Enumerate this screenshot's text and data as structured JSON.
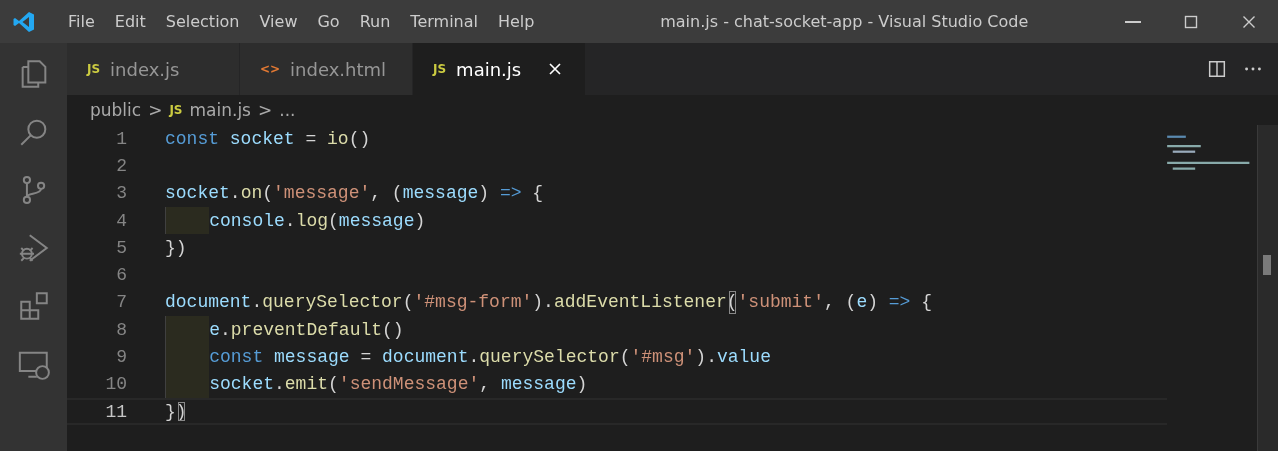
{
  "window": {
    "title": "main.js - chat-socket-app - Visual Studio Code"
  },
  "menu": [
    "File",
    "Edit",
    "Selection",
    "View",
    "Go",
    "Run",
    "Terminal",
    "Help"
  ],
  "tabs": [
    {
      "label": "index.js",
      "kind": "js",
      "icon_text": "JS",
      "selected": false
    },
    {
      "label": "index.html",
      "kind": "html",
      "icon_text": "<>",
      "selected": false
    },
    {
      "label": "main.js",
      "kind": "js",
      "icon_text": "JS",
      "selected": true
    }
  ],
  "breadcrumb": {
    "folder": "public",
    "file_icon": "JS",
    "file": "main.js",
    "separator": ">",
    "more": "..."
  },
  "editor": {
    "lines": [
      {
        "number": "1",
        "indented": false,
        "current": false,
        "tokens": [
          {
            "kind": "kw",
            "text": "const "
          },
          {
            "kind": "var",
            "text": "socket"
          },
          {
            "kind": "punc",
            "text": " = "
          },
          {
            "kind": "fn",
            "text": "io"
          },
          {
            "kind": "punc",
            "text": "()"
          }
        ]
      },
      {
        "number": "2",
        "indented": false,
        "current": false
      },
      {
        "number": "3",
        "indented": false,
        "current": false,
        "tokens": [
          {
            "kind": "var",
            "text": "socket"
          },
          {
            "kind": "punc",
            "text": "."
          },
          {
            "kind": "fn",
            "text": "on"
          },
          {
            "kind": "punc",
            "text": "("
          },
          {
            "kind": "str",
            "text": "'message'"
          },
          {
            "kind": "punc",
            "text": ", ("
          },
          {
            "kind": "var",
            "text": "message"
          },
          {
            "kind": "punc",
            "text": ") "
          },
          {
            "kind": "kw",
            "text": "=>"
          },
          {
            "kind": "punc",
            "text": " {"
          }
        ]
      },
      {
        "number": "4",
        "indented": true,
        "current": false,
        "tokens": [
          {
            "kind": "var",
            "text": "console"
          },
          {
            "kind": "punc",
            "text": "."
          },
          {
            "kind": "fn",
            "text": "log"
          },
          {
            "kind": "punc",
            "text": "("
          },
          {
            "kind": "var",
            "text": "message"
          },
          {
            "kind": "punc",
            "text": ")"
          }
        ]
      },
      {
        "number": "5",
        "indented": false,
        "current": false,
        "tokens": [
          {
            "kind": "punc",
            "text": "})"
          }
        ]
      },
      {
        "number": "6",
        "indented": false,
        "current": false
      },
      {
        "number": "7",
        "indented": false,
        "current": false,
        "tokens": [
          {
            "kind": "var",
            "text": "document"
          },
          {
            "kind": "punc",
            "text": "."
          },
          {
            "kind": "fn",
            "text": "querySelector"
          },
          {
            "kind": "punc",
            "text": "("
          },
          {
            "kind": "str",
            "text": "'#msg-form'"
          },
          {
            "kind": "punc",
            "text": ")."
          },
          {
            "kind": "fn",
            "text": "addEventListener"
          },
          {
            "kind": "bracket",
            "text": "("
          },
          {
            "kind": "str",
            "text": "'submit'"
          },
          {
            "kind": "punc",
            "text": ", ("
          },
          {
            "kind": "var",
            "text": "e"
          },
          {
            "kind": "punc",
            "text": ") "
          },
          {
            "kind": "kw",
            "text": "=>"
          },
          {
            "kind": "punc",
            "text": " {"
          }
        ]
      },
      {
        "number": "8",
        "indented": true,
        "current": false,
        "tokens": [
          {
            "kind": "var",
            "text": "e"
          },
          {
            "kind": "punc",
            "text": "."
          },
          {
            "kind": "fn",
            "text": "preventDefault"
          },
          {
            "kind": "punc",
            "text": "()"
          }
        ]
      },
      {
        "number": "9",
        "indented": true,
        "current": false,
        "tokens": [
          {
            "kind": "kw",
            "text": "const "
          },
          {
            "kind": "var",
            "text": "message"
          },
          {
            "kind": "punc",
            "text": " = "
          },
          {
            "kind": "var",
            "text": "document"
          },
          {
            "kind": "punc",
            "text": "."
          },
          {
            "kind": "fn",
            "text": "querySelector"
          },
          {
            "kind": "punc",
            "text": "("
          },
          {
            "kind": "str",
            "text": "'#msg'"
          },
          {
            "kind": "punc",
            "text": ")."
          },
          {
            "kind": "var",
            "text": "value"
          }
        ]
      },
      {
        "number": "10",
        "indented": true,
        "current": false,
        "tokens": [
          {
            "kind": "var",
            "text": "socket"
          },
          {
            "kind": "punc",
            "text": "."
          },
          {
            "kind": "fn",
            "text": "emit"
          },
          {
            "kind": "punc",
            "text": "("
          },
          {
            "kind": "str",
            "text": "'sendMessage'"
          },
          {
            "kind": "punc",
            "text": ", "
          },
          {
            "kind": "var",
            "text": "message"
          },
          {
            "kind": "punc",
            "text": ")"
          }
        ]
      },
      {
        "number": "11",
        "indented": false,
        "current": true,
        "tokens": [
          {
            "kind": "punc",
            "text": "}"
          },
          {
            "kind": "bracket",
            "text": ")"
          }
        ]
      }
    ]
  }
}
